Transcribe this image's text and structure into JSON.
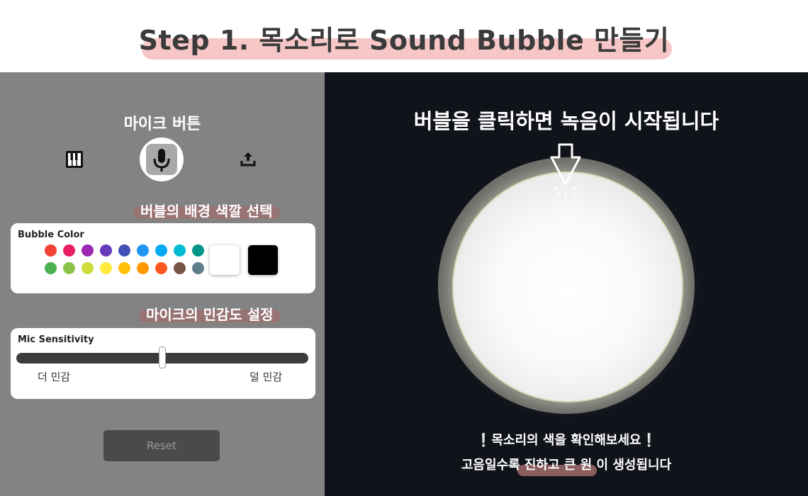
{
  "header": {
    "title": "Step 1. 목소리로 Sound Bubble 만들기"
  },
  "left_panel": {
    "section_title": "마이크 버튼",
    "tools": [
      {
        "icon": "piano-icon"
      },
      {
        "icon": "microphone-icon",
        "selected": true
      },
      {
        "icon": "upload-icon"
      }
    ],
    "color_label": "버블의 배경 색깔 선택",
    "color_card": {
      "title": "Bubble Color",
      "swatch_colors": [
        "#f44336",
        "#e91e63",
        "#9c27b0",
        "#673ab7",
        "#3f51b5",
        "#2196f3",
        "#03a9f4",
        "#00bcd4",
        "#009688",
        "#4caf50",
        "#8bc34a",
        "#cddc39",
        "#ffeb3b",
        "#ffc107",
        "#ff9800",
        "#ff5722",
        "#795548",
        "#607d8b"
      ],
      "large_swatches": [
        "#ffffff",
        "#000000"
      ]
    },
    "mic_label": "마이크의 민감도 설정",
    "mic_card": {
      "title": "Mic Sensitivity",
      "left_label": "더 민감",
      "right_label": "덜 민감",
      "value": 0.5
    },
    "reset_label": "Reset"
  },
  "right_panel": {
    "instruction": "버블을 클릭하면 녹음이 시작됩니다",
    "note_line1": "❕목소리의 색을 확인해보세요❕",
    "note_line2": "고음일수록 진하고 큰 원 이 생성됩니다"
  },
  "colors": {
    "left_bg": "#838383",
    "right_bg": "#11131b",
    "title_highlight": "#f7c7c7",
    "label_highlight": "#9c7171"
  }
}
